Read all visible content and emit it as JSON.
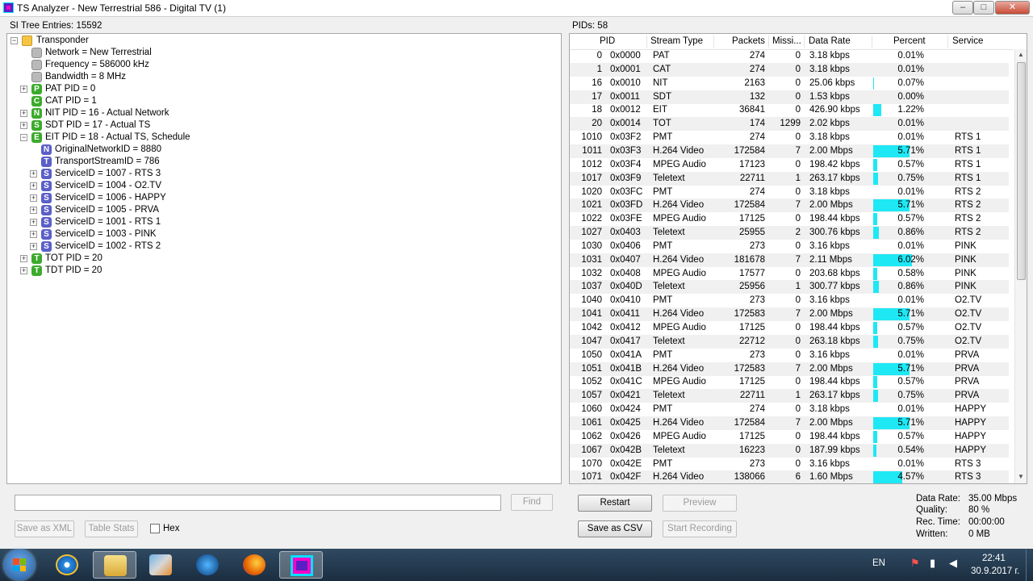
{
  "window": {
    "title": "TS Analyzer - New Terrestrial 586 - Digital TV (1)",
    "min": "–",
    "max": "□",
    "close": "✕"
  },
  "left": {
    "entries_label": "SI Tree Entries: 15592",
    "tree": [
      {
        "text": "Transponder",
        "indent": 0,
        "exp": "−",
        "icon": "folder",
        "letter": ""
      },
      {
        "text": "Network = New Terrestrial",
        "indent": 1,
        "exp": "",
        "icon": "gray",
        "letter": ""
      },
      {
        "text": "Frequency = 586000 kHz",
        "indent": 1,
        "exp": "",
        "icon": "gray",
        "letter": ""
      },
      {
        "text": "Bandwidth = 8 MHz",
        "indent": 1,
        "exp": "",
        "icon": "gray",
        "letter": ""
      },
      {
        "text": "PAT PID = 0",
        "indent": 1,
        "exp": "+",
        "icon": "green",
        "letter": "P"
      },
      {
        "text": "CAT PID = 1",
        "indent": 1,
        "exp": "",
        "icon": "green",
        "letter": "C"
      },
      {
        "text": "NIT PID = 16 - Actual Network",
        "indent": 1,
        "exp": "+",
        "icon": "green",
        "letter": "N"
      },
      {
        "text": "SDT PID = 17 - Actual TS",
        "indent": 1,
        "exp": "+",
        "icon": "green",
        "letter": "S"
      },
      {
        "text": "EIT PID = 18 - Actual TS, Schedule",
        "indent": 1,
        "exp": "−",
        "icon": "green",
        "letter": "E"
      },
      {
        "text": "OriginalNetworkID = 8880",
        "indent": 2,
        "exp": "",
        "icon": "purple",
        "letter": "N"
      },
      {
        "text": "TransportStreamID = 786",
        "indent": 2,
        "exp": "",
        "icon": "purple",
        "letter": "T"
      },
      {
        "text": "ServiceID = 1007 - RTS 3",
        "indent": 2,
        "exp": "+",
        "icon": "purple",
        "letter": "S"
      },
      {
        "text": "ServiceID = 1004 - O2.TV",
        "indent": 2,
        "exp": "+",
        "icon": "purple",
        "letter": "S"
      },
      {
        "text": "ServiceID = 1006 - HAPPY",
        "indent": 2,
        "exp": "+",
        "icon": "purple",
        "letter": "S"
      },
      {
        "text": "ServiceID = 1005 - PRVA",
        "indent": 2,
        "exp": "+",
        "icon": "purple",
        "letter": "S"
      },
      {
        "text": "ServiceID = 1001 - RTS 1",
        "indent": 2,
        "exp": "+",
        "icon": "purple",
        "letter": "S"
      },
      {
        "text": "ServiceID = 1003 - PINK",
        "indent": 2,
        "exp": "+",
        "icon": "purple",
        "letter": "S"
      },
      {
        "text": "ServiceID = 1002 - RTS 2",
        "indent": 2,
        "exp": "+",
        "icon": "purple",
        "letter": "S"
      },
      {
        "text": "TOT PID = 20",
        "indent": 1,
        "exp": "+",
        "icon": "green",
        "letter": "T"
      },
      {
        "text": "TDT PID = 20",
        "indent": 1,
        "exp": "+",
        "icon": "green",
        "letter": "T"
      }
    ],
    "search_value": "",
    "find_label": "Find",
    "save_xml_label": "Save as XML",
    "table_stats_label": "Table Stats",
    "hex_label": "Hex"
  },
  "right": {
    "pids_label": "PIDs: 58",
    "columns": [
      "PID",
      "Stream Type",
      "Packets",
      "Missi...",
      "Data Rate",
      "Percent",
      "Service"
    ],
    "rows": [
      {
        "pid": "0",
        "hex": "0x0000",
        "type": "PAT",
        "packets": "274",
        "missing": "0",
        "rate": "3.18 kbps",
        "percent": "0.01%",
        "pct": 0.01,
        "service": ""
      },
      {
        "pid": "1",
        "hex": "0x0001",
        "type": "CAT",
        "packets": "274",
        "missing": "0",
        "rate": "3.18 kbps",
        "percent": "0.01%",
        "pct": 0.01,
        "service": ""
      },
      {
        "pid": "16",
        "hex": "0x0010",
        "type": "NIT",
        "packets": "2163",
        "missing": "0",
        "rate": "25.06 kbps",
        "percent": "0.07%",
        "pct": 0.07,
        "service": ""
      },
      {
        "pid": "17",
        "hex": "0x0011",
        "type": "SDT",
        "packets": "132",
        "missing": "0",
        "rate": "1.53 kbps",
        "percent": "0.00%",
        "pct": 0.0,
        "service": ""
      },
      {
        "pid": "18",
        "hex": "0x0012",
        "type": "EIT",
        "packets": "36841",
        "missing": "0",
        "rate": "426.90 kbps",
        "percent": "1.22%",
        "pct": 1.22,
        "service": ""
      },
      {
        "pid": "20",
        "hex": "0x0014",
        "type": "TOT",
        "packets": "174",
        "missing": "1299",
        "rate": "2.02 kbps",
        "percent": "0.01%",
        "pct": 0.01,
        "service": ""
      },
      {
        "pid": "1010",
        "hex": "0x03F2",
        "type": "PMT",
        "packets": "274",
        "missing": "0",
        "rate": "3.18 kbps",
        "percent": "0.01%",
        "pct": 0.01,
        "service": "RTS 1"
      },
      {
        "pid": "1011",
        "hex": "0x03F3",
        "type": "H.264 Video",
        "packets": "172584",
        "missing": "7",
        "rate": "2.00 Mbps",
        "percent": "5.71%",
        "pct": 5.71,
        "service": "RTS 1"
      },
      {
        "pid": "1012",
        "hex": "0x03F4",
        "type": "MPEG Audio",
        "packets": "17123",
        "missing": "0",
        "rate": "198.42 kbps",
        "percent": "0.57%",
        "pct": 0.57,
        "service": "RTS 1"
      },
      {
        "pid": "1017",
        "hex": "0x03F9",
        "type": "Teletext",
        "packets": "22711",
        "missing": "1",
        "rate": "263.17 kbps",
        "percent": "0.75%",
        "pct": 0.75,
        "service": "RTS 1"
      },
      {
        "pid": "1020",
        "hex": "0x03FC",
        "type": "PMT",
        "packets": "274",
        "missing": "0",
        "rate": "3.18 kbps",
        "percent": "0.01%",
        "pct": 0.01,
        "service": "RTS 2"
      },
      {
        "pid": "1021",
        "hex": "0x03FD",
        "type": "H.264 Video",
        "packets": "172584",
        "missing": "7",
        "rate": "2.00 Mbps",
        "percent": "5.71%",
        "pct": 5.71,
        "service": "RTS 2"
      },
      {
        "pid": "1022",
        "hex": "0x03FE",
        "type": "MPEG Audio",
        "packets": "17125",
        "missing": "0",
        "rate": "198.44 kbps",
        "percent": "0.57%",
        "pct": 0.57,
        "service": "RTS 2"
      },
      {
        "pid": "1027",
        "hex": "0x0403",
        "type": "Teletext",
        "packets": "25955",
        "missing": "2",
        "rate": "300.76 kbps",
        "percent": "0.86%",
        "pct": 0.86,
        "service": "RTS 2"
      },
      {
        "pid": "1030",
        "hex": "0x0406",
        "type": "PMT",
        "packets": "273",
        "missing": "0",
        "rate": "3.16 kbps",
        "percent": "0.01%",
        "pct": 0.01,
        "service": "PINK"
      },
      {
        "pid": "1031",
        "hex": "0x0407",
        "type": "H.264 Video",
        "packets": "181678",
        "missing": "7",
        "rate": "2.11 Mbps",
        "percent": "6.02%",
        "pct": 6.02,
        "service": "PINK"
      },
      {
        "pid": "1032",
        "hex": "0x0408",
        "type": "MPEG Audio",
        "packets": "17577",
        "missing": "0",
        "rate": "203.68 kbps",
        "percent": "0.58%",
        "pct": 0.58,
        "service": "PINK"
      },
      {
        "pid": "1037",
        "hex": "0x040D",
        "type": "Teletext",
        "packets": "25956",
        "missing": "1",
        "rate": "300.77 kbps",
        "percent": "0.86%",
        "pct": 0.86,
        "service": "PINK"
      },
      {
        "pid": "1040",
        "hex": "0x0410",
        "type": "PMT",
        "packets": "273",
        "missing": "0",
        "rate": "3.16 kbps",
        "percent": "0.01%",
        "pct": 0.01,
        "service": "O2.TV"
      },
      {
        "pid": "1041",
        "hex": "0x0411",
        "type": "H.264 Video",
        "packets": "172583",
        "missing": "7",
        "rate": "2.00 Mbps",
        "percent": "5.71%",
        "pct": 5.71,
        "service": "O2.TV"
      },
      {
        "pid": "1042",
        "hex": "0x0412",
        "type": "MPEG Audio",
        "packets": "17125",
        "missing": "0",
        "rate": "198.44 kbps",
        "percent": "0.57%",
        "pct": 0.57,
        "service": "O2.TV"
      },
      {
        "pid": "1047",
        "hex": "0x0417",
        "type": "Teletext",
        "packets": "22712",
        "missing": "0",
        "rate": "263.18 kbps",
        "percent": "0.75%",
        "pct": 0.75,
        "service": "O2.TV"
      },
      {
        "pid": "1050",
        "hex": "0x041A",
        "type": "PMT",
        "packets": "273",
        "missing": "0",
        "rate": "3.16 kbps",
        "percent": "0.01%",
        "pct": 0.01,
        "service": "PRVA"
      },
      {
        "pid": "1051",
        "hex": "0x041B",
        "type": "H.264 Video",
        "packets": "172583",
        "missing": "7",
        "rate": "2.00 Mbps",
        "percent": "5.71%",
        "pct": 5.71,
        "service": "PRVA"
      },
      {
        "pid": "1052",
        "hex": "0x041C",
        "type": "MPEG Audio",
        "packets": "17125",
        "missing": "0",
        "rate": "198.44 kbps",
        "percent": "0.57%",
        "pct": 0.57,
        "service": "PRVA"
      },
      {
        "pid": "1057",
        "hex": "0x0421",
        "type": "Teletext",
        "packets": "22711",
        "missing": "1",
        "rate": "263.17 kbps",
        "percent": "0.75%",
        "pct": 0.75,
        "service": "PRVA"
      },
      {
        "pid": "1060",
        "hex": "0x0424",
        "type": "PMT",
        "packets": "274",
        "missing": "0",
        "rate": "3.18 kbps",
        "percent": "0.01%",
        "pct": 0.01,
        "service": "HAPPY"
      },
      {
        "pid": "1061",
        "hex": "0x0425",
        "type": "H.264 Video",
        "packets": "172584",
        "missing": "7",
        "rate": "2.00 Mbps",
        "percent": "5.71%",
        "pct": 5.71,
        "service": "HAPPY"
      },
      {
        "pid": "1062",
        "hex": "0x0426",
        "type": "MPEG Audio",
        "packets": "17125",
        "missing": "0",
        "rate": "198.44 kbps",
        "percent": "0.57%",
        "pct": 0.57,
        "service": "HAPPY"
      },
      {
        "pid": "1067",
        "hex": "0x042B",
        "type": "Teletext",
        "packets": "16223",
        "missing": "0",
        "rate": "187.99 kbps",
        "percent": "0.54%",
        "pct": 0.54,
        "service": "HAPPY"
      },
      {
        "pid": "1070",
        "hex": "0x042E",
        "type": "PMT",
        "packets": "273",
        "missing": "0",
        "rate": "3.16 kbps",
        "percent": "0.01%",
        "pct": 0.01,
        "service": "RTS 3"
      },
      {
        "pid": "1071",
        "hex": "0x042F",
        "type": "H.264 Video",
        "packets": "138066",
        "missing": "6",
        "rate": "1.60 Mbps",
        "percent": "4.57%",
        "pct": 4.57,
        "service": "RTS 3"
      }
    ],
    "bar_color": "#1ee8f4",
    "restart_label": "Restart",
    "preview_label": "Preview",
    "save_csv_label": "Save as CSV",
    "start_recording_label": "Start Recording",
    "stats": {
      "data_rate_label": "Data Rate:",
      "data_rate_value": "35.00 Mbps",
      "quality_label": "Quality:",
      "quality_value": "80 %",
      "rec_time_label": "Rec. Time:",
      "rec_time_value": "00:00:00",
      "written_label": "Written:",
      "written_value": "0 MB"
    }
  },
  "taskbar": {
    "apps": [
      "start-button",
      "internet-explorer-icon",
      "file-explorer-icon",
      "maps-icon",
      "media-player-icon",
      "firefox-icon",
      "ts-analyzer-icon"
    ],
    "language": "EN",
    "time": "22:41",
    "date": "30.9.2017 г."
  }
}
